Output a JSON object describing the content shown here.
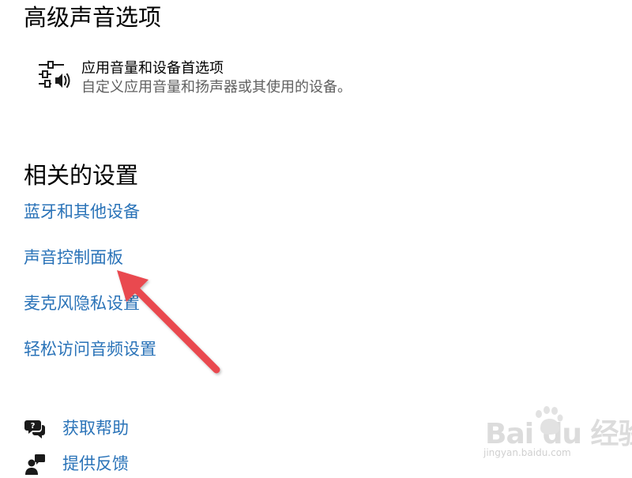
{
  "advanced": {
    "title": "高级声音选项",
    "option": {
      "icon": "sliders-volume-icon",
      "title": "应用音量和设备首选项",
      "description": "自定义应用音量和扬声器或其使用的设备。"
    }
  },
  "related": {
    "title": "相关的设置",
    "links": [
      "蓝牙和其他设备",
      "声音控制面板",
      "麦克风隐私设置",
      "轻松访问音频设置"
    ]
  },
  "footer": {
    "help": {
      "icon": "chat-help-icon",
      "label": "获取帮助"
    },
    "feedback": {
      "icon": "feedback-person-icon",
      "label": "提供反馈"
    }
  },
  "watermark": {
    "logo": "Bai du 经验",
    "url": "jingyan.baidu.com"
  },
  "colors": {
    "link": "#2a73b8",
    "arrow": "#e9484f"
  }
}
